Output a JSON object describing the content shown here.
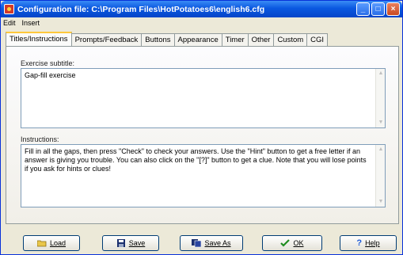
{
  "window": {
    "title": "Configuration file: C:\\Program Files\\HotPotatoes6\\english6.cfg"
  },
  "menu": [
    "Edit",
    "Insert"
  ],
  "tabs": [
    {
      "label": "Titles/Instructions",
      "active": true
    },
    {
      "label": "Prompts/Feedback"
    },
    {
      "label": "Buttons"
    },
    {
      "label": "Appearance"
    },
    {
      "label": "Timer"
    },
    {
      "label": "Other"
    },
    {
      "label": "Custom"
    },
    {
      "label": "CGI"
    }
  ],
  "subtitle": {
    "label": "Exercise subtitle:",
    "value": "Gap-fill exercise"
  },
  "instructions": {
    "label": "Instructions:",
    "value": "Fill in all the gaps, then press \"Check\" to check your answers. Use the \"Hint\" button to get a free letter if an answer is giving you trouble. You can also click on the \"[?]\" button to get a clue. Note that you will lose points if you ask for hints or clues!"
  },
  "buttons": {
    "load": "Load",
    "save": "Save",
    "save_as": "Save As",
    "ok": "OK",
    "help": "Help"
  },
  "colors": {
    "title_bar": "#0a58e0",
    "face": "#ece9d8",
    "ok_check": "#1f8c1f",
    "help_q": "#1e5bd8"
  }
}
